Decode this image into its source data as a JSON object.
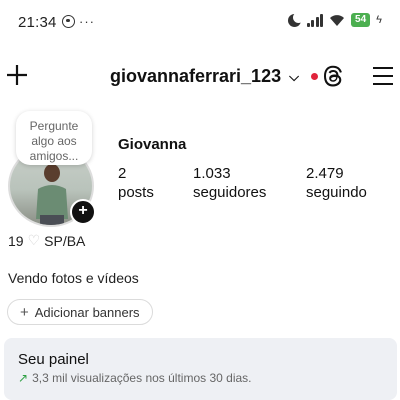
{
  "status_bar": {
    "time": "21:34",
    "more": "···",
    "battery": "54"
  },
  "header": {
    "username": "giovannaferrari_123"
  },
  "profile": {
    "note": "Pergunte algo aos amigos...",
    "display_name": "Giovanna",
    "stats": [
      {
        "value": "2",
        "label": "posts"
      },
      {
        "value": "1.033",
        "label": "seguidores"
      },
      {
        "value": "2.479",
        "label": "seguindo"
      }
    ],
    "meta_count": "19",
    "meta_location": "SP/BA",
    "bio": "Vendo fotos e vídeos",
    "banner_button": "Adicionar banners"
  },
  "panel": {
    "title": "Seu painel",
    "subtitle": "3,3 mil visualizações nos últimos 30 dias."
  },
  "colors": {
    "accent_red": "#e0243b",
    "battery_green": "#4caf50",
    "trend_green": "#2ea043",
    "panel_bg": "#eef0f4"
  }
}
